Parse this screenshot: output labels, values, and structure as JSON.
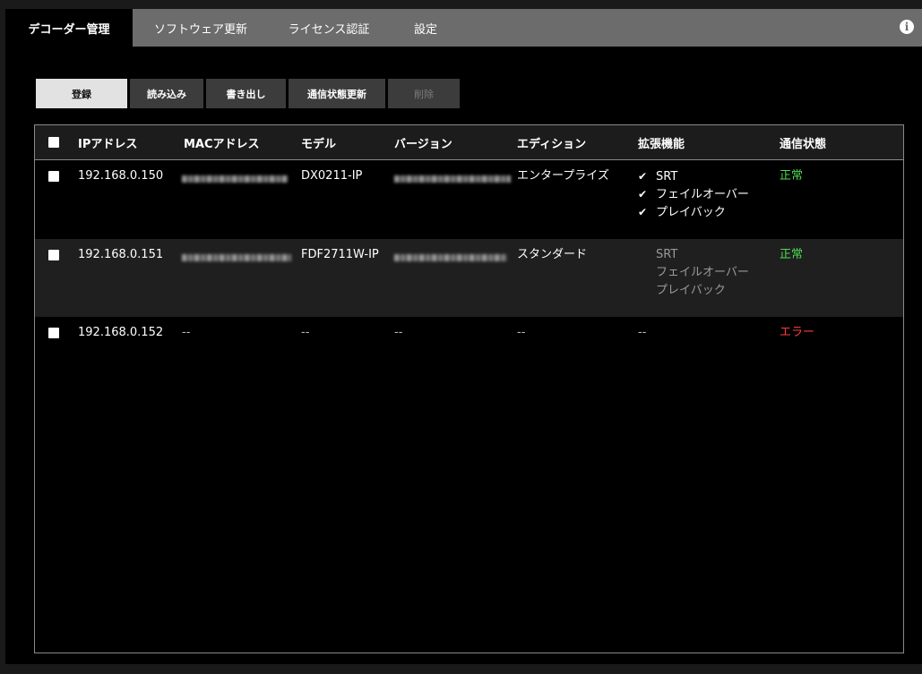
{
  "tabs": [
    "デコーダー管理",
    "ソフトウェア更新",
    "ライセンス認証",
    "設定"
  ],
  "info_icon": "info-icon",
  "toolbar": {
    "register": "登録",
    "import": "読み込み",
    "export": "書き出し",
    "refresh_status": "通信状態更新",
    "delete": "削除"
  },
  "table": {
    "headers": {
      "ip": "IPアドレス",
      "mac": "MACアドレス",
      "model": "モデル",
      "version": "バージョン",
      "edition": "エディション",
      "extensions": "拡張機能",
      "status": "通信状態"
    },
    "rows": [
      {
        "ip": "192.168.0.150",
        "mac": "[blurred]",
        "model": "DX0211-IP",
        "version": "[blurred]",
        "edition": "エンタープライズ",
        "features": [
          {
            "label": "SRT",
            "enabled": true
          },
          {
            "label": "フェイルオーバー",
            "enabled": true
          },
          {
            "label": "プレイバック",
            "enabled": true
          }
        ],
        "status": "正常",
        "status_color": "#4ddb52"
      },
      {
        "ip": "192.168.0.151",
        "mac": "[blurred]",
        "model": "FDF2711W-IP",
        "version": "[blurred]",
        "edition": "スタンダード",
        "features": [
          {
            "label": "SRT",
            "enabled": false
          },
          {
            "label": "フェイルオーバー",
            "enabled": false
          },
          {
            "label": "プレイバック",
            "enabled": false
          }
        ],
        "status": "正常",
        "status_color": "#4ddb52"
      },
      {
        "ip": "192.168.0.152",
        "mac": "--",
        "model": "--",
        "version": "--",
        "edition": "--",
        "extensions": "--",
        "status": "エラー",
        "status_color": "#ff3b3b"
      }
    ]
  },
  "check_mark": "✔"
}
